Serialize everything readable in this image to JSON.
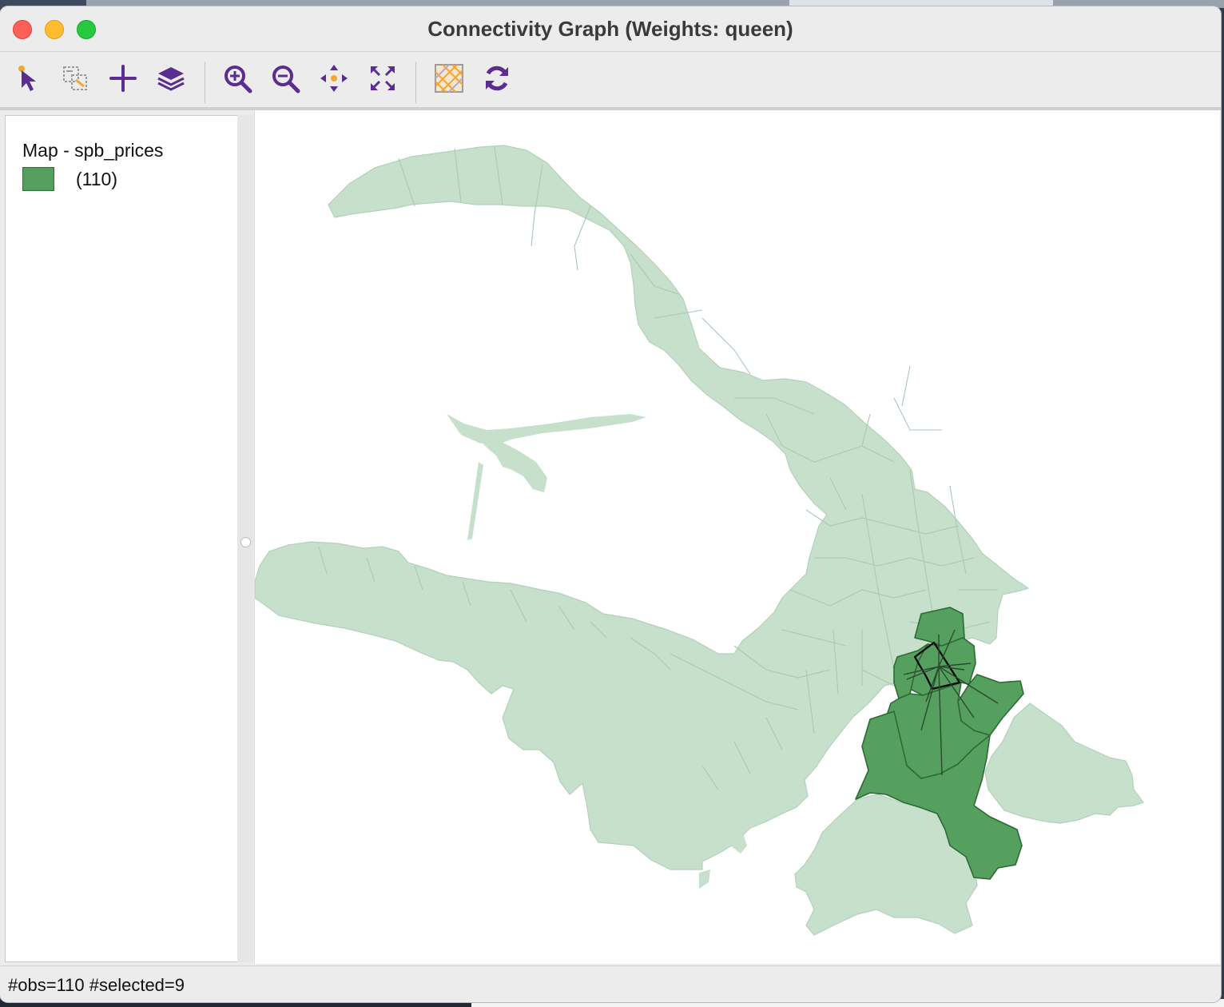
{
  "window": {
    "title": "Connectivity Graph (Weights: queen)"
  },
  "toolbar": {
    "buttons": [
      {
        "name": "select-tool-icon"
      },
      {
        "name": "selection-options-icon"
      },
      {
        "name": "add-icon"
      },
      {
        "name": "layers-icon"
      },
      {
        "name": "zoom-in-icon"
      },
      {
        "name": "zoom-out-icon"
      },
      {
        "name": "pan-icon"
      },
      {
        "name": "full-extent-icon"
      },
      {
        "name": "basemap-icon"
      },
      {
        "name": "refresh-icon"
      }
    ],
    "icon_color": "#5b2d91",
    "accent_color": "#f0a830"
  },
  "legend": {
    "title": "Map - spb_prices",
    "items": [
      {
        "label": "(110)",
        "color": "#56a05f"
      }
    ]
  },
  "map": {
    "base_fill": "#c6e0cc",
    "selected_fill": "#56a05f",
    "focus_outline": "#000000",
    "selected_count": 9
  },
  "status": {
    "text": "#obs=110 #selected=9"
  }
}
